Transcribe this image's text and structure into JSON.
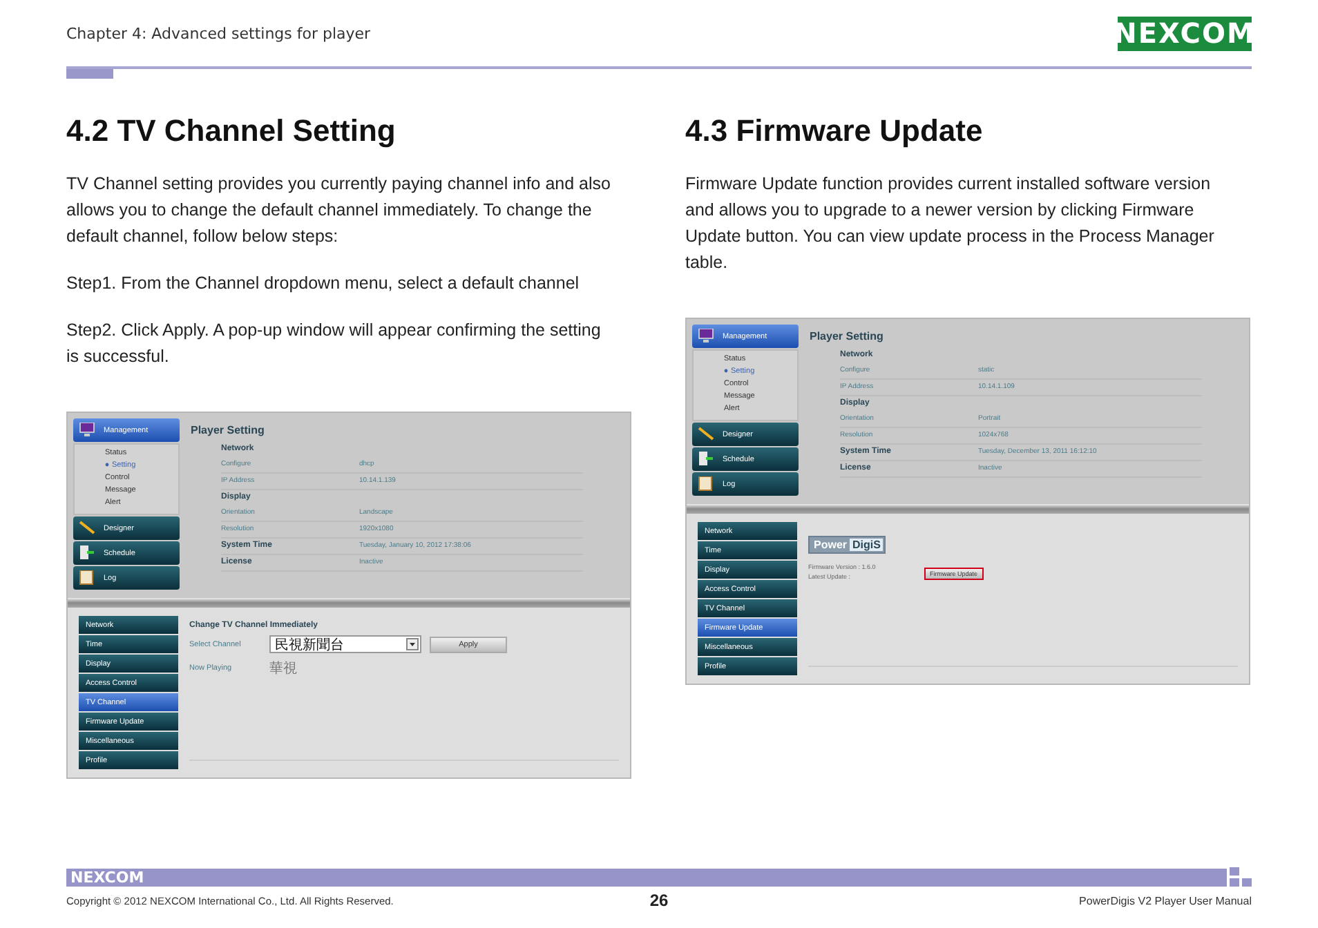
{
  "header": {
    "chapter": "Chapter 4: Advanced settings for player",
    "logo": "NEXCOM"
  },
  "sections": [
    {
      "heading": "4.2 TV Channel Setting",
      "paragraphs": [
        "TV Channel setting provides you currently paying channel info and also allows you to change the default channel immediately. To change the default channel, follow below steps:",
        "Step1. From the Channel dropdown menu, select a default channel",
        "Step2. Click Apply. A pop-up window will appear confirming the setting is successful."
      ],
      "screenshot": {
        "menu": [
          {
            "label": "Management",
            "selected": true,
            "children": [
              {
                "label": "Status",
                "selected": false
              },
              {
                "label": "Setting",
                "selected": true
              },
              {
                "label": "Control",
                "selected": false
              },
              {
                "label": "Message",
                "selected": false
              },
              {
                "label": "Alert",
                "selected": false
              }
            ]
          },
          {
            "label": "Designer",
            "selected": false
          },
          {
            "label": "Schedule",
            "selected": false
          },
          {
            "label": "Log",
            "selected": false
          }
        ],
        "player_setting": {
          "title": "Player Setting",
          "groups": [
            {
              "heading": "Network",
              "rows": [
                {
                  "label": "Configure",
                  "value": "dhcp"
                },
                {
                  "label": "IP Address",
                  "value": "10.14.1.139"
                }
              ]
            },
            {
              "heading": "Display",
              "rows": [
                {
                  "label": "Orientation",
                  "value": "Landscape"
                },
                {
                  "label": "Resolution",
                  "value": "1920x1080"
                }
              ]
            },
            {
              "heading": "System Time",
              "rows": [
                {
                  "label": "",
                  "value": "Tuesday, January 10, 2012 17:38:06"
                }
              ]
            },
            {
              "heading": "License",
              "rows": [
                {
                  "label": "",
                  "value": "Inactive"
                }
              ]
            }
          ]
        },
        "sub_menu": [
          {
            "label": "Network",
            "selected": false
          },
          {
            "label": "Time",
            "selected": false
          },
          {
            "label": "Display",
            "selected": false
          },
          {
            "label": "Access Control",
            "selected": false
          },
          {
            "label": "TV Channel",
            "selected": true
          },
          {
            "label": "Firmware Update",
            "selected": false
          },
          {
            "label": "Miscellaneous",
            "selected": false
          },
          {
            "label": "Profile",
            "selected": false
          }
        ],
        "panel": {
          "kind": "channel",
          "title": "Change TV Channel Immediately",
          "select_label": "Select Channel",
          "select_value": "民視新聞台",
          "button": "Apply",
          "playing_label": "Now Playing",
          "playing_value": "華視"
        }
      }
    },
    {
      "heading": "4.3 Firmware Update",
      "paragraphs": [
        "Firmware Update function provides current installed software version and allows you to upgrade to a newer version by clicking Firmware Update button. You can view update process in the Process Manager table."
      ],
      "screenshot": {
        "menu": [
          {
            "label": "Management",
            "selected": true,
            "children": [
              {
                "label": "Status",
                "selected": false
              },
              {
                "label": "Setting",
                "selected": true
              },
              {
                "label": "Control",
                "selected": false
              },
              {
                "label": "Message",
                "selected": false
              },
              {
                "label": "Alert",
                "selected": false
              }
            ]
          },
          {
            "label": "Designer",
            "selected": false
          },
          {
            "label": "Schedule",
            "selected": false
          },
          {
            "label": "Log",
            "selected": false
          }
        ],
        "player_setting": {
          "title": "Player Setting",
          "groups": [
            {
              "heading": "Network",
              "rows": [
                {
                  "label": "Configure",
                  "value": "static"
                },
                {
                  "label": "IP Address",
                  "value": "10.14.1.109"
                }
              ]
            },
            {
              "heading": "Display",
              "rows": [
                {
                  "label": "Orientation",
                  "value": "Portrait"
                },
                {
                  "label": "Resolution",
                  "value": "1024x768"
                }
              ]
            },
            {
              "heading": "System Time",
              "rows": [
                {
                  "label": "",
                  "value": "Tuesday, December 13, 2011 16:12:10"
                }
              ]
            },
            {
              "heading": "License",
              "rows": [
                {
                  "label": "",
                  "value": "Inactive"
                }
              ]
            }
          ]
        },
        "sub_menu": [
          {
            "label": "Network",
            "selected": false
          },
          {
            "label": "Time",
            "selected": false
          },
          {
            "label": "Display",
            "selected": false
          },
          {
            "label": "Access Control",
            "selected": false
          },
          {
            "label": "TV Channel",
            "selected": false
          },
          {
            "label": "Firmware Update",
            "selected": true
          },
          {
            "label": "Miscellaneous",
            "selected": false
          },
          {
            "label": "Profile",
            "selected": false
          }
        ],
        "panel": {
          "kind": "firmware",
          "logo": [
            "Power",
            "DigiS"
          ],
          "version": "Firmware Version : 1.6.0",
          "latest": "Latest Update :",
          "button": "Firmware Update",
          "highlighted": true
        }
      }
    }
  ],
  "footer": {
    "logo": "NEXCOM",
    "copyright": "Copyright © 2012 NEXCOM International Co., Ltd. All Rights Reserved.",
    "page": "26",
    "manual": "PowerDigis V2 Player User Manual"
  }
}
